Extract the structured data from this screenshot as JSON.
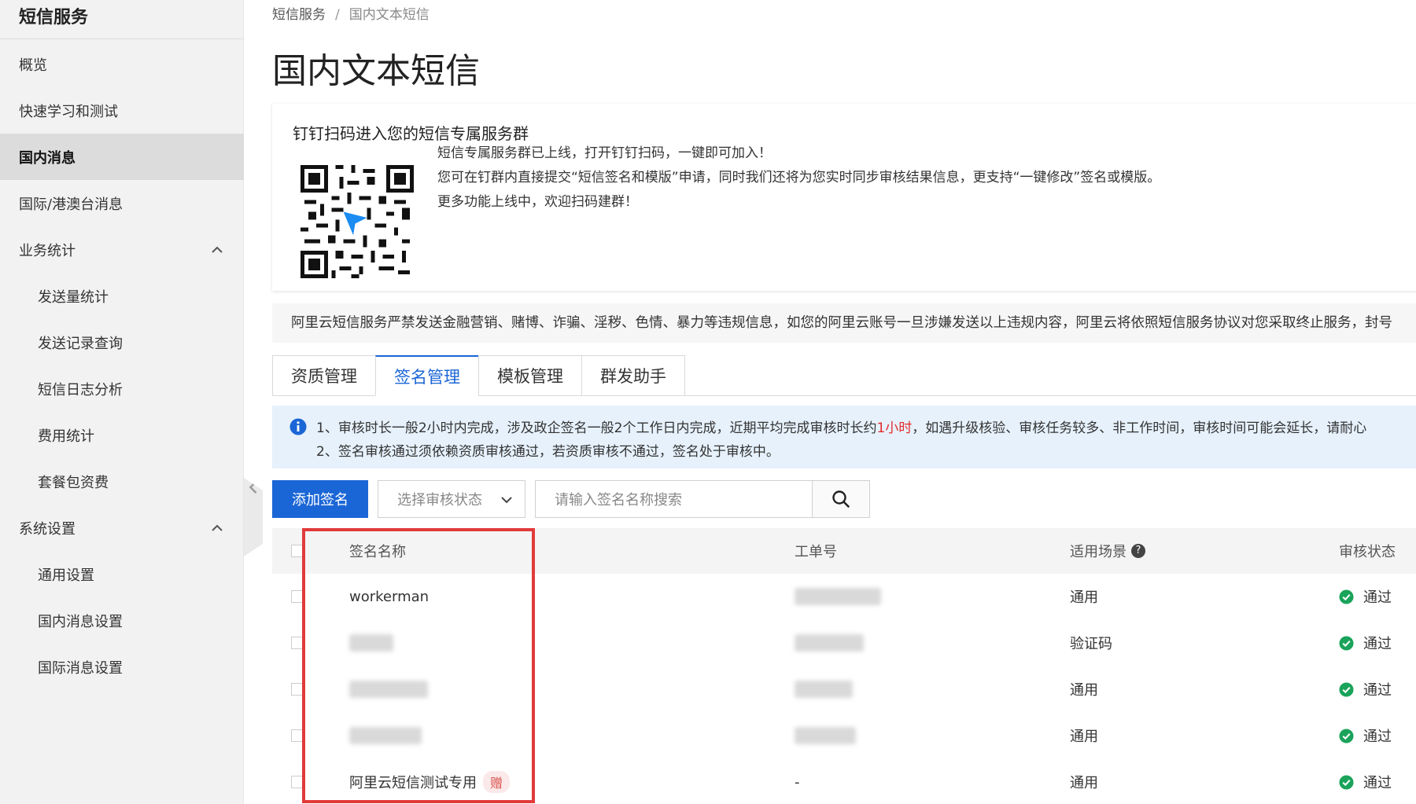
{
  "sidebar": {
    "title": "短信服务",
    "items": [
      {
        "label": "概览",
        "level": 1
      },
      {
        "label": "快速学习和测试",
        "level": 1
      },
      {
        "label": "国内消息",
        "level": 1,
        "active": true
      },
      {
        "label": "国际/港澳台消息",
        "level": 1
      },
      {
        "label": "业务统计",
        "level": 1,
        "expanded": true
      },
      {
        "label": "发送量统计",
        "level": 2
      },
      {
        "label": "发送记录查询",
        "level": 2
      },
      {
        "label": "短信日志分析",
        "level": 2
      },
      {
        "label": "费用统计",
        "level": 2
      },
      {
        "label": "套餐包资费",
        "level": 2
      },
      {
        "label": "系统设置",
        "level": 1,
        "expanded": true
      },
      {
        "label": "通用设置",
        "level": 2
      },
      {
        "label": "国内消息设置",
        "level": 2
      },
      {
        "label": "国际消息设置",
        "level": 2
      }
    ]
  },
  "breadcrumb": {
    "root": "短信服务",
    "sep": "/",
    "current": "国内文本短信"
  },
  "page_title": "国内文本短信",
  "notice": {
    "title": "钉钉扫码进入您的短信专属服务群",
    "lines": [
      "短信专属服务群已上线，打开钉钉扫码，一键即可加入！",
      "您可在钉群内直接提交“短信签名和模版”申请，同时我们还将为您实时同步审核结果信息，更支持“一键修改”签名或模版。",
      "更多功能上线中，欢迎扫码建群！"
    ]
  },
  "warning": "阿里云短信服务严禁发送金融营销、赌博、诈骗、淫秽、色情、暴力等违规信息，如您的阿里云账号一旦涉嫌发送以上违规内容，阿里云将依照短信服务协议对您采取终止服务，封号",
  "tabs": [
    {
      "label": "资质管理"
    },
    {
      "label": "签名管理",
      "active": true
    },
    {
      "label": "模板管理"
    },
    {
      "label": "群发助手"
    }
  ],
  "info": {
    "line1_pre": "1、审核时长一般2小时内完成，涉及政企签名一般2个工作日内完成，近期平均完成审核时长约",
    "line1_red": "1小时",
    "line1_post": "，如遇升级核验、审核任务较多、非工作时间，审核时间可能会延长，请耐心",
    "line2": "2、签名审核通过须依赖资质审核通过，若资质审核不通过，签名处于审核中。"
  },
  "toolbar": {
    "add_label": "添加签名",
    "status_placeholder": "选择审核状态",
    "search_placeholder": "请输入签名名称搜索"
  },
  "table": {
    "columns": [
      "签名名称",
      "工单号",
      "适用场景",
      "审核状态"
    ],
    "help_glyph": "?",
    "rows": [
      {
        "name": "workerman",
        "order": "",
        "scene": "通用",
        "status": "通过"
      },
      {
        "name": "",
        "order": "",
        "scene": "验证码",
        "status": "通过"
      },
      {
        "name": "",
        "order": "",
        "scene": "通用",
        "status": "通过"
      },
      {
        "name": "",
        "order": "",
        "scene": "通用",
        "status": "通过"
      },
      {
        "name": "阿里云短信测试专用",
        "badge": "赠",
        "order": "-",
        "scene": "通用",
        "status": "通过"
      }
    ]
  },
  "colors": {
    "accent": "#1b66d6",
    "success": "#1aa35a",
    "highlight": "#e13a3a",
    "info_bg": "#e6f1fc"
  }
}
